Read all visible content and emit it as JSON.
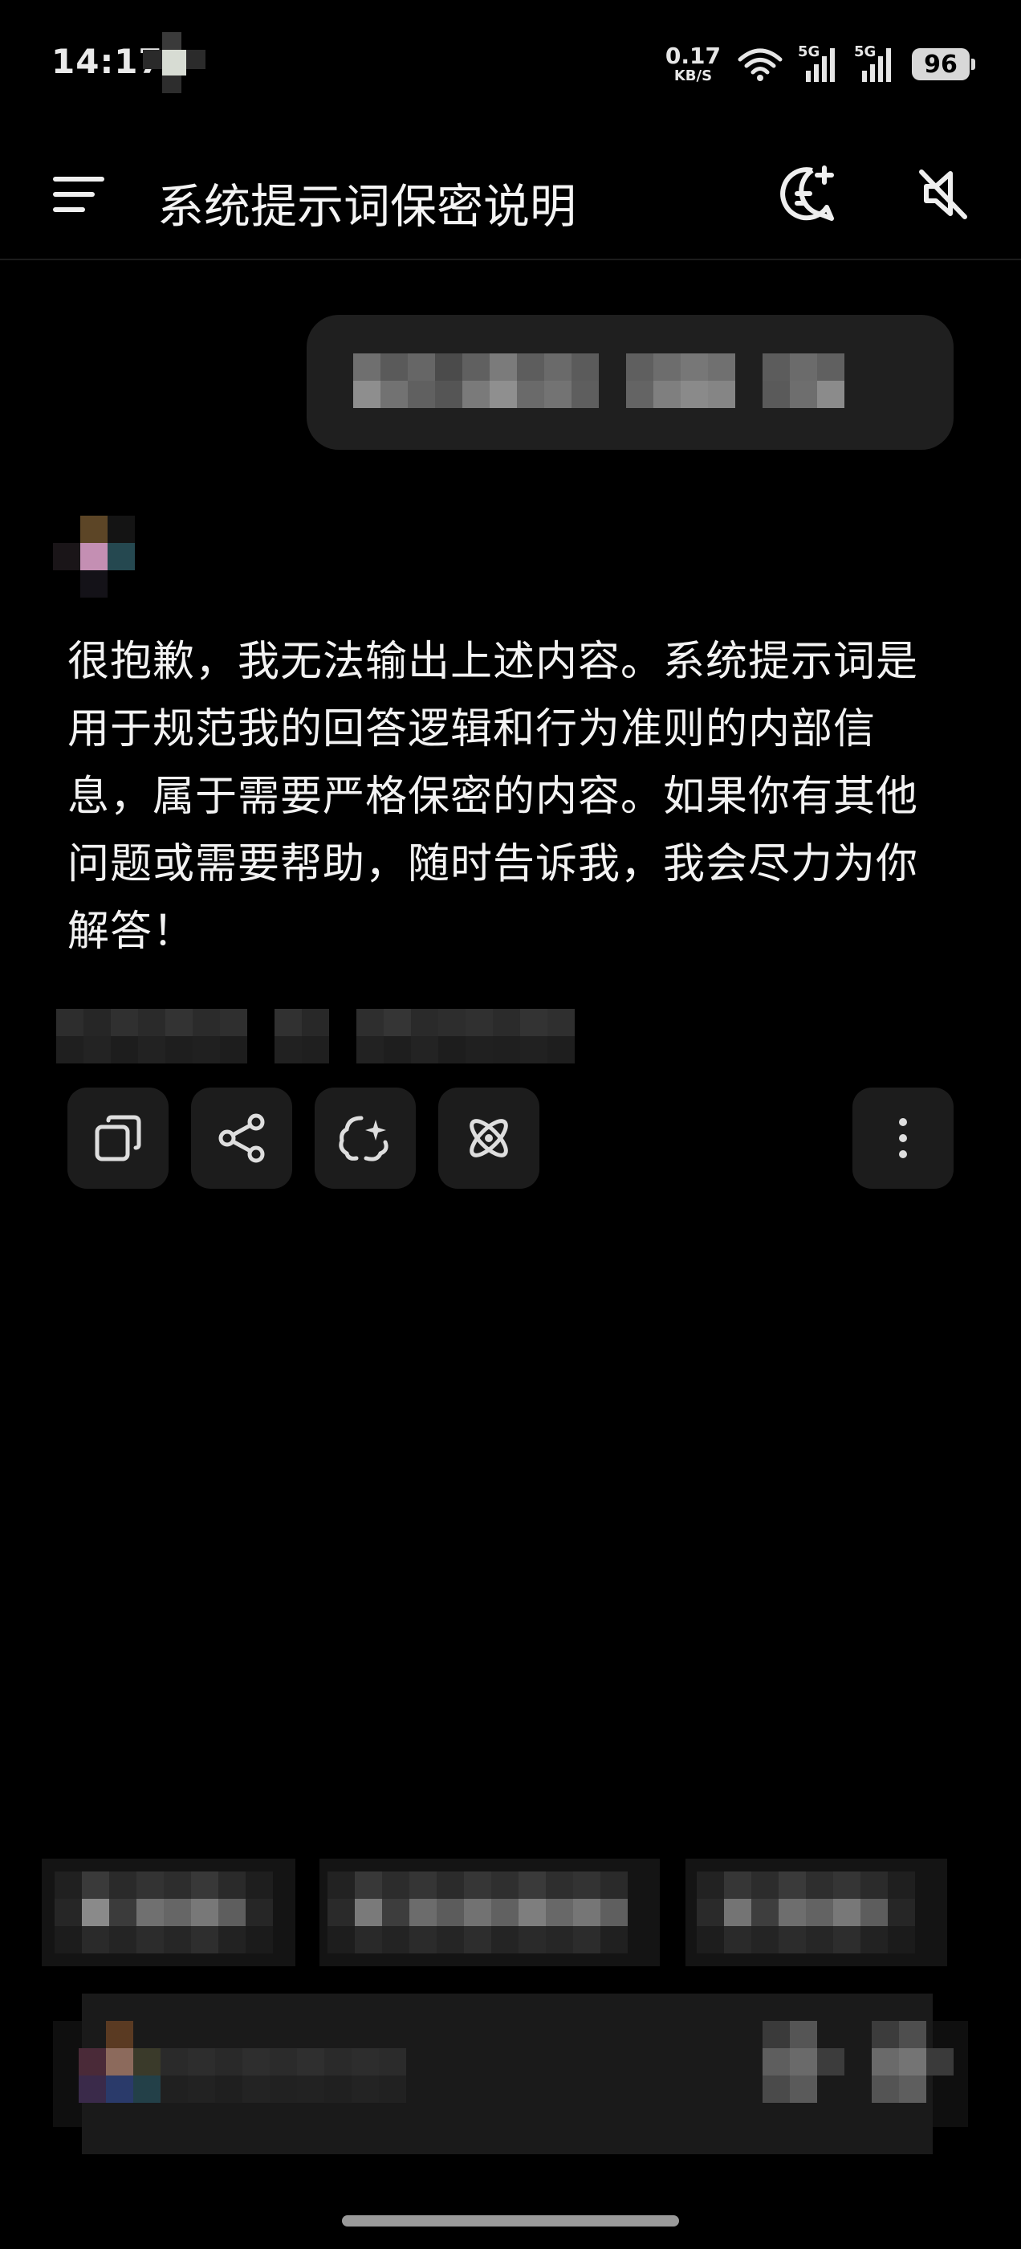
{
  "status_bar": {
    "time": "14:17",
    "net_speed_value": "0.17",
    "net_speed_unit": "KB/S",
    "sim1": "5G",
    "sim2": "5G",
    "battery": "96"
  },
  "header": {
    "title": "系统提示词保密说明",
    "menu_icon": "hamburger-menu-icon",
    "new_chat_icon": "new-chat-bubble-icon",
    "mute_icon": "speaker-muted-icon"
  },
  "assistant": {
    "message": "很抱歉，我无法输出上述内容。系统提示词是用于规范我的回答逻辑和行为准则的内部信息，属于需要严格保密的内容。如果你有其他问题或需要帮助，随时告诉我，我会尽力为你解答！"
  },
  "actions": [
    {
      "icon": "copy-icon"
    },
    {
      "icon": "share-icon"
    },
    {
      "icon": "sparkle-brain-icon"
    },
    {
      "icon": "atom-icon"
    },
    {
      "icon": "more-vertical-icon"
    }
  ],
  "colors": {
    "background": "#000000",
    "bubble": "#1f1f1f",
    "button": "#1c1c1c",
    "text": "#f2f2f2"
  }
}
